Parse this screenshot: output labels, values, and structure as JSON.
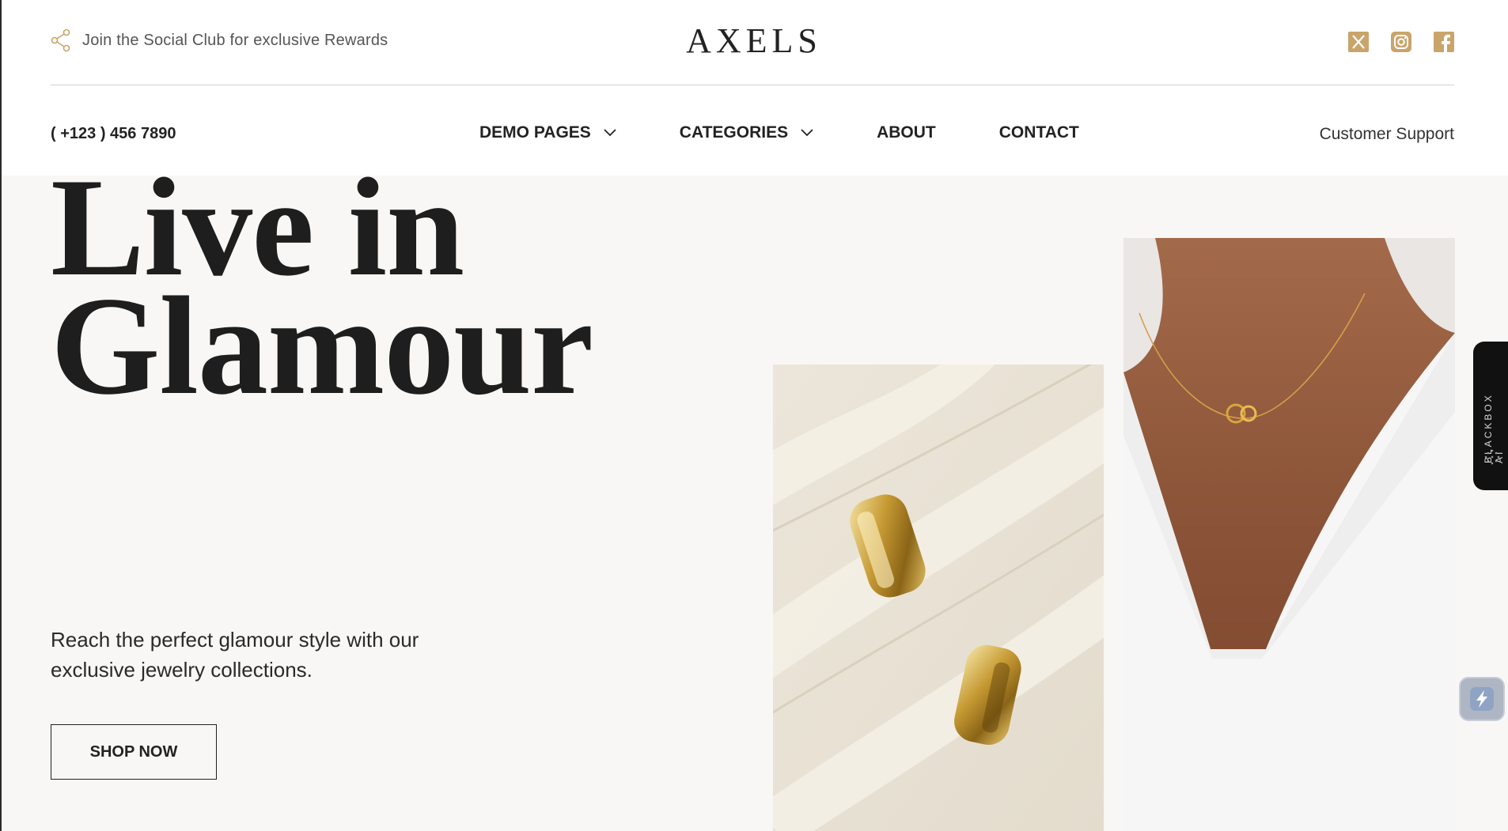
{
  "topbar": {
    "promo_text": "Join the Social Club for exclusive Rewards",
    "brand": "AXELS",
    "socials": [
      "x-icon",
      "instagram-icon",
      "facebook-icon"
    ],
    "accent_color": "#c9a46b"
  },
  "nav": {
    "phone": "( +123 ) 456 7890",
    "items": [
      {
        "label": "DEMO PAGES",
        "has_dropdown": true
      },
      {
        "label": "CATEGORIES",
        "has_dropdown": true
      },
      {
        "label": "ABOUT",
        "has_dropdown": false
      },
      {
        "label": "CONTACT",
        "has_dropdown": false
      }
    ],
    "support": "Customer Support"
  },
  "hero": {
    "headline_line1": "Live in",
    "headline_line2": "Glamour",
    "subtext": "Reach the perfect glamour style with our exclusive jewelry collections.",
    "cta": "SHOP NOW",
    "background": "#f8f7f5"
  },
  "sidebar_tab": {
    "label": "BLACKBOX AI"
  }
}
